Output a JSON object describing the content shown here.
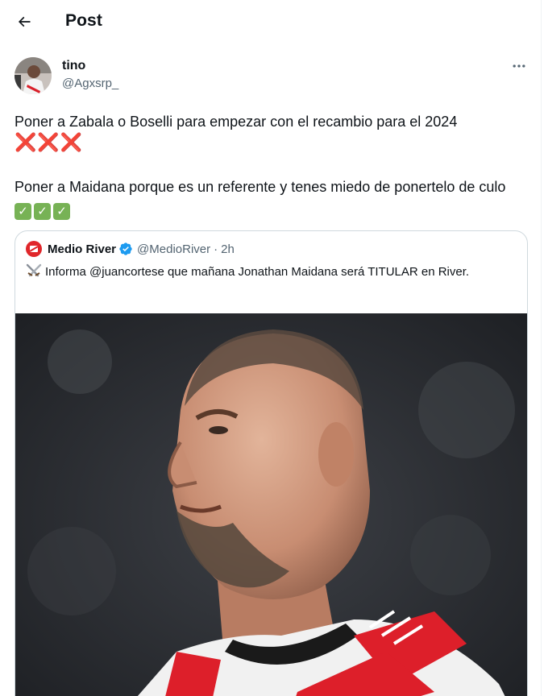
{
  "header": {
    "title": "Post"
  },
  "icons": {
    "back": "back-arrow-icon",
    "more": "more-dots-icon",
    "verified": "verified-badge-icon",
    "swords": "crossed-swords-icon"
  },
  "tweet": {
    "author_name": "tino",
    "author_handle": "@Agxsrp_",
    "text_part1": "Poner a Zabala o Boselli para empezar con el recambio para el 2024 ",
    "x_marks": "❌❌❌",
    "text_part2": "Poner a Maidana porque es un referente y tenes miedo de ponertelo de culo ",
    "check_marks": "✅✅✅"
  },
  "quote": {
    "account_name": "Medio River",
    "handle": "@MedioRiver",
    "separator": "·",
    "time": "2h",
    "text": "Informa @juancortese que mañana Jonathan Maidana será TITULAR en River."
  },
  "colors": {
    "text_primary": "#0f1419",
    "text_secondary": "#536471",
    "border": "#cfd9de",
    "verified_blue": "#1d9bf0",
    "river_red": "#e0262a"
  }
}
